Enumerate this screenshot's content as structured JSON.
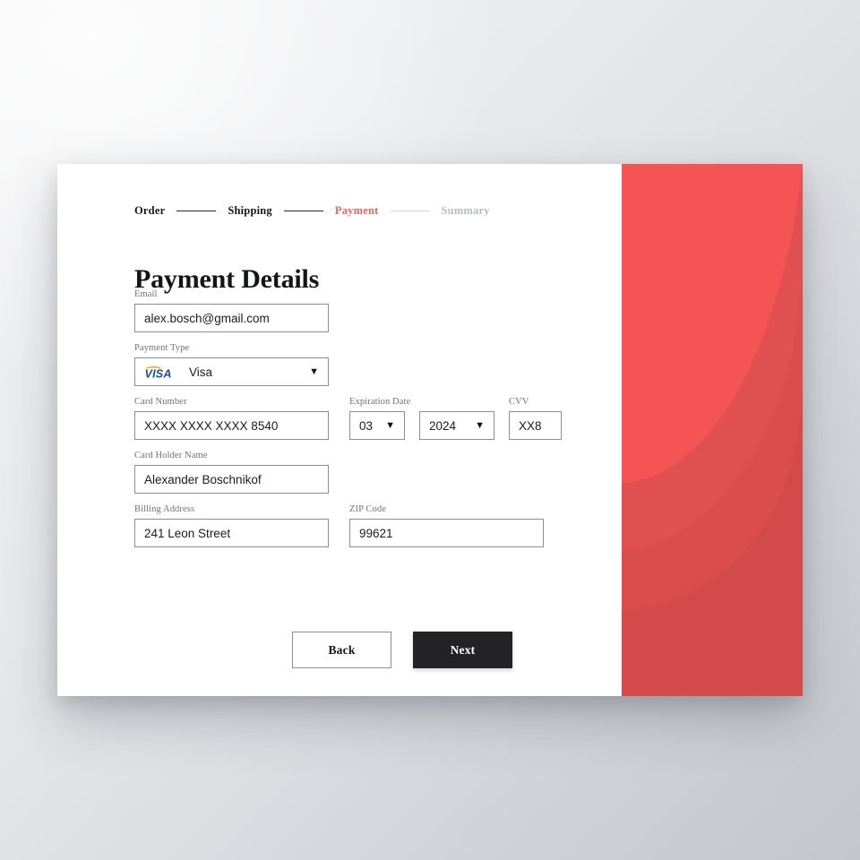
{
  "theme": {
    "accent_red": "#f4615e",
    "panel_red": "#f55454",
    "panel_red_mid": "#db4c4c",
    "panel_red_dark": "#d4494a",
    "button_dark": "#232325",
    "border_gray": "#8b8d91",
    "label_gray": "#6f7276",
    "muted_gray": "#b9bbbf"
  },
  "stepper": {
    "steps": [
      {
        "label": "Order",
        "state": "done"
      },
      {
        "label": "Shipping",
        "state": "done"
      },
      {
        "label": "Payment",
        "state": "active"
      },
      {
        "label": "Summary",
        "state": "todo"
      }
    ]
  },
  "page": {
    "title": "Payment Details"
  },
  "form": {
    "email": {
      "label": "Email",
      "value": "alex.bosch@gmail.com",
      "placeholder": "Email"
    },
    "payment_type": {
      "label": "Payment Type",
      "value": "Visa",
      "brand_icon": "visa-logo",
      "caret_icon": "chevron-down-icon"
    },
    "card_number": {
      "label": "Card Number",
      "value": "XXXX XXXX XXXX 8540",
      "placeholder": "Card Number"
    },
    "expiration": {
      "label": "Expiration Date",
      "month": "03",
      "year": "2024",
      "caret_icon": "chevron-down-icon"
    },
    "cvv": {
      "label": "CVV",
      "value": "XX8",
      "placeholder": "CVV"
    },
    "card_holder": {
      "label": "Card Holder Name",
      "value": "Alexander Boschnikof",
      "placeholder": "Card Holder Name"
    },
    "billing_address": {
      "label": "Billing Address",
      "value": "241 Leon Street",
      "placeholder": "Billing Address"
    },
    "zip": {
      "label": "ZIP Code",
      "value": "99621",
      "placeholder": "ZIP Code"
    }
  },
  "actions": {
    "back_label": "Back",
    "next_label": "Next"
  },
  "decor": {
    "panel_name": "red-arc-panel"
  }
}
